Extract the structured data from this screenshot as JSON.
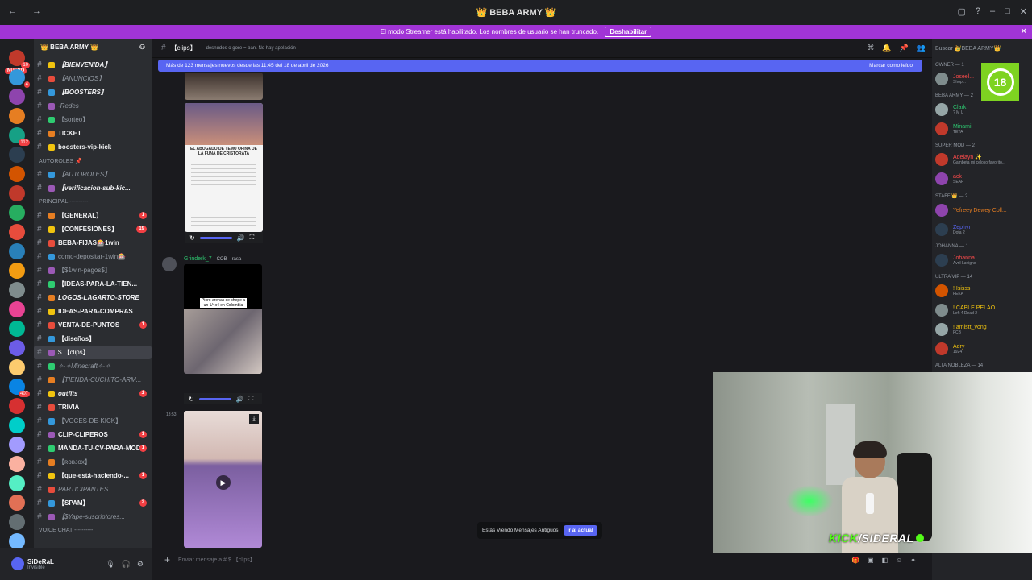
{
  "titlebar": {
    "title": "👑 BEBA ARMY 👑"
  },
  "banner": {
    "text": "El modo Streamer está habilitado. Los nombres de usuario se han truncado.",
    "button": "Deshabilitar"
  },
  "servers": {
    "nuevo": "NUEVO",
    "badges": [
      "10",
      "4",
      "",
      "",
      "112",
      "",
      "",
      "",
      "",
      "",
      "",
      "",
      "",
      "",
      "",
      "",
      "",
      "407",
      "",
      "",
      "",
      "",
      "",
      "",
      "",
      "",
      ""
    ]
  },
  "server_name": "👑 BEBA ARMY 👑",
  "channels": [
    {
      "label": "【BIENVENIDA】",
      "style": "bold italic"
    },
    {
      "label": "【ANUNCIOS】",
      "style": "italic"
    },
    {
      "label": "【BOOSTERS】",
      "style": "bold italic"
    },
    {
      "label": "-Redes",
      "style": "italic"
    },
    {
      "label": "【sorteo】",
      "style": ""
    },
    {
      "label": "TICKET",
      "style": "bold"
    },
    {
      "label": "boosters-vip-kick",
      "style": "bold"
    },
    {
      "label": "AUTOROLES 📌",
      "style": "cat"
    },
    {
      "label": "【AUTOROLES】",
      "style": "italic"
    },
    {
      "label": "【verificacion-sub-kic...",
      "style": "bold italic"
    },
    {
      "label": "PRINCIPAL ----------",
      "style": "cat"
    },
    {
      "label": "【GENERAL】",
      "style": "bold",
      "count": "1"
    },
    {
      "label": "【CONFESIONES】",
      "style": "bold",
      "count": "19"
    },
    {
      "label": "BEBA-FIJAS🎰1win",
      "style": "bold"
    },
    {
      "label": "como-depositar-1win🎰",
      "style": ""
    },
    {
      "label": "【$1win-pagos$】",
      "style": ""
    },
    {
      "label": "【IDEAS-PARA-LA-TIEN...",
      "style": "bold"
    },
    {
      "label": "LOGOS-LAGARTO-STORE",
      "style": "bold italic"
    },
    {
      "label": "IDEAS-PARA-COMPRAS",
      "style": "bold"
    },
    {
      "label": "VENTA-DE-PUNTOS",
      "style": "bold",
      "count": "1"
    },
    {
      "label": "【diseños】",
      "style": "bold"
    },
    {
      "label": "$ 【clips】",
      "style": "active"
    },
    {
      "label": "✧·✧Minecraft✧·✧",
      "style": "italic"
    },
    {
      "label": "【TIENDA-CUCHITO-ARM...",
      "style": "italic"
    },
    {
      "label": "outfits",
      "style": "bold italic",
      "count": "1"
    },
    {
      "label": "TRIVIA",
      "style": "bold"
    },
    {
      "label": "【VOCES-DE-KICK】",
      "style": ""
    },
    {
      "label": "CLIP-CLIPEROS",
      "style": "bold",
      "count": "1"
    },
    {
      "label": "MANDA-TU-CV-PARA-MOD",
      "style": "bold",
      "count": "1"
    },
    {
      "label": "【ʀᴏʙᴊᴏx】",
      "style": ""
    },
    {
      "label": "【que-está-haciendo-...",
      "style": "bold",
      "count": "1"
    },
    {
      "label": "PARTICIPANTES",
      "style": "italic"
    },
    {
      "label": "【SPAM】",
      "style": "bold",
      "count": "2"
    },
    {
      "label": "【$Yape-suscriptores...",
      "style": "italic"
    },
    {
      "label": "VOICE CHAT ----------",
      "style": "cat"
    }
  ],
  "user": {
    "name": "SiDeRaL",
    "status": "Invisible"
  },
  "channel_header": {
    "name": "【clips】",
    "topic": "desnudos o gore = ban. No hay apelación"
  },
  "newbar": {
    "text": "Más de 123 mensajes nuevos desde las 11:45 del 18 de abril de 2026",
    "mark": "Marcar como leído"
  },
  "message": {
    "author": "Grinderk_7",
    "tag1": "COB",
    "tag2": "rasa",
    "time": "13:53"
  },
  "image_captions": {
    "lawyer": "EL ABOGADO DE TEMU OPINA DE LA FUNA DE CRISTORATA",
    "video1": "Pioro arenas se chepe a un 1/4x4 en Colombia"
  },
  "old_messages": {
    "text": "Estás Viendo Mensajes Antiguos",
    "button": "Ir al actual"
  },
  "composer": {
    "placeholder": "Enviar mensaje a # $ 【clips】"
  },
  "members": {
    "search": "Buscar 👑BEBA ARMY👑",
    "groups": [
      {
        "title": "OWNER — 1",
        "items": [
          {
            "name": "Joseel...",
            "sub": "Shop...",
            "color": "#ff4b4b"
          }
        ]
      },
      {
        "title": "BEBA ARMY — 2",
        "items": [
          {
            "name": "Clark.",
            "sub": "? M U",
            "color": "#2dc770"
          },
          {
            "name": "Minami",
            "sub": "TETA",
            "color": "#2dc770"
          }
        ]
      },
      {
        "title": "SUPER MOD — 2",
        "items": [
          {
            "name": "Adelayn ✨",
            "sub": "Gambeta mi celoso favorito...",
            "color": "#ff4b4b"
          },
          {
            "name": "ack",
            "sub": "SEAF",
            "color": "#ff4b4b"
          }
        ]
      },
      {
        "title": "STAFF 👑 — 2",
        "items": [
          {
            "name": "Yefreey Dewey Coll...",
            "sub": "",
            "color": "#e67e22"
          },
          {
            "name": "Zephyr",
            "sub": "Dota 2",
            "color": "#5865f2"
          }
        ]
      },
      {
        "title": "Johanna — 1",
        "items": [
          {
            "name": "Johanna",
            "sub": "Avril Lavigne",
            "color": "#ff4b4b"
          }
        ]
      },
      {
        "title": "ULTRA VIP — 14",
        "items": [
          {
            "name": "! Isisss",
            "sub": "FEKA",
            "color": "#f1c40f"
          },
          {
            "name": "! CABLE PELAO",
            "sub": "Left 4 Dead 2",
            "color": "#f1c40f"
          },
          {
            "name": "! amistt_vong",
            "sub": "FCB",
            "color": "#f1c40f"
          },
          {
            "name": "Adry",
            "sub": "1924",
            "color": "#f1c40f"
          }
        ]
      },
      {
        "title": "ALTA NOBLEZA — 14",
        "items": []
      }
    ]
  },
  "age_badge": "18",
  "webcam": {
    "brand_main": "KICK",
    "brand_user": "SIDERAL"
  }
}
